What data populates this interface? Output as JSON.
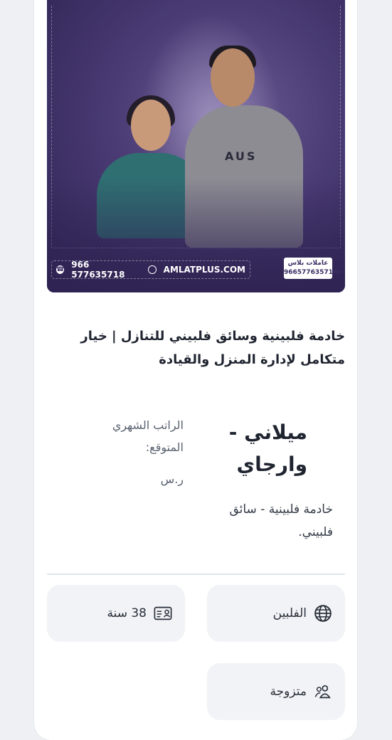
{
  "photo": {
    "phone": "966 577635718",
    "website": "AMLATPLUS.COM",
    "shirt_text": "AUS",
    "logo": {
      "name": "عاملات بلاس",
      "phone": "966577635718+"
    }
  },
  "listing": {
    "title": "خادمة فلبينية وسائق فلبيني للتنازل | خيار متكامل لإدارة المنزل والقيادة",
    "name": "ميلاني - وارجاي",
    "role": "خادمة فلبينية - سائق فلبيني.",
    "salary_label": "الراتب الشهري المتوقع:",
    "salary_currency": "ر.س"
  },
  "details": {
    "nationality": {
      "icon": "globe-icon",
      "value": "الفلبين"
    },
    "age": {
      "icon": "id-card-icon",
      "value": "38 سنة"
    },
    "marital_status": {
      "icon": "users-icon",
      "value": "متزوجة"
    }
  }
}
